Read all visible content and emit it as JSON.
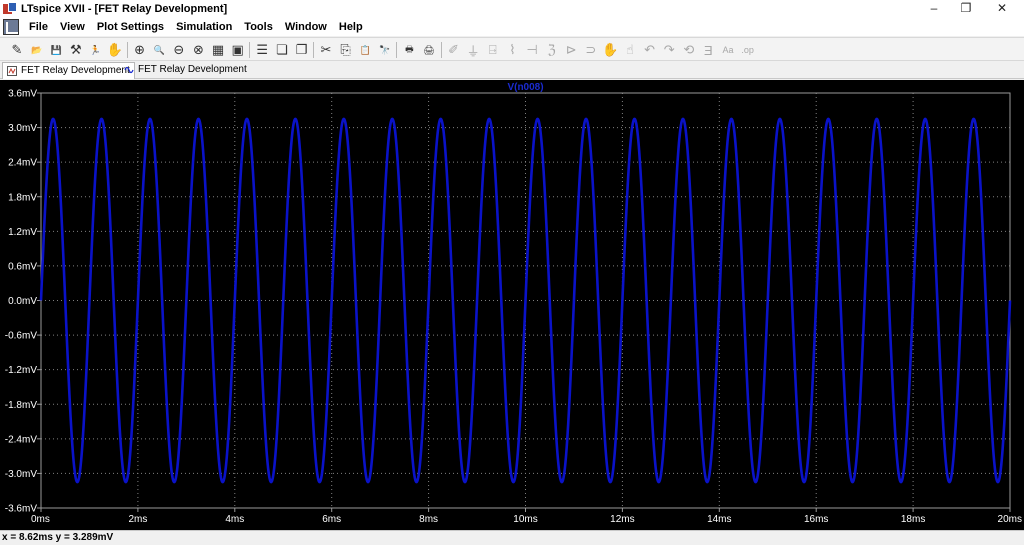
{
  "window": {
    "title": "LTspice XVII - [FET Relay Development]",
    "controls": {
      "minimize": "–",
      "restore": "❐",
      "close": "✕"
    }
  },
  "menubar": {
    "items": [
      "File",
      "View",
      "Plot Settings",
      "Simulation",
      "Tools",
      "Window",
      "Help"
    ],
    "mdi_controls": {
      "minimize": "_",
      "restore": "▫",
      "close": "x"
    }
  },
  "toolbar": {
    "buttons": [
      {
        "name": "open-schematic-icon",
        "glyph": "✎"
      },
      {
        "name": "open-folder-icon",
        "glyph": "📂"
      },
      {
        "name": "save-icon",
        "glyph": "💾"
      },
      {
        "name": "control-panel-icon",
        "glyph": "⚒"
      },
      {
        "name": "run-icon",
        "glyph": "🏃"
      },
      {
        "name": "halt-icon",
        "glyph": "✋"
      },
      {
        "name": "zoom-in-icon",
        "glyph": "⊕"
      },
      {
        "name": "zoom-pan-icon",
        "glyph": "🔍"
      },
      {
        "name": "zoom-out-icon",
        "glyph": "⊖"
      },
      {
        "name": "zoom-fit-icon",
        "glyph": "⊗"
      },
      {
        "name": "autorange-icon",
        "glyph": "▦"
      },
      {
        "name": "fit-icon",
        "glyph": "▣"
      },
      {
        "name": "tile-horizontal-icon",
        "glyph": "☰"
      },
      {
        "name": "cascade-icon",
        "glyph": "❏"
      },
      {
        "name": "tile-vertical-icon",
        "glyph": "❐"
      },
      {
        "name": "cut-icon",
        "glyph": "✂"
      },
      {
        "name": "copy-icon",
        "glyph": "⎘"
      },
      {
        "name": "paste-icon",
        "glyph": "📋"
      },
      {
        "name": "find-icon",
        "glyph": "🔭"
      },
      {
        "name": "print-icon",
        "glyph": "🖶"
      },
      {
        "name": "print-setup-icon",
        "glyph": "🖨"
      },
      {
        "name": "wire-icon",
        "glyph": "✐"
      },
      {
        "name": "ground-icon",
        "glyph": "⏚"
      },
      {
        "name": "label-icon",
        "glyph": "⍈"
      },
      {
        "name": "resistor-icon",
        "glyph": "⌇"
      },
      {
        "name": "capacitor-icon",
        "glyph": "⊣"
      },
      {
        "name": "inductor-icon",
        "glyph": "ℨ"
      },
      {
        "name": "diode-icon",
        "glyph": "⊳"
      },
      {
        "name": "component-icon",
        "glyph": "⊃"
      },
      {
        "name": "move-icon",
        "glyph": "✋"
      },
      {
        "name": "drag-icon",
        "glyph": "☝"
      },
      {
        "name": "undo-icon",
        "glyph": "↶"
      },
      {
        "name": "redo-icon",
        "glyph": "↷"
      },
      {
        "name": "rotate-icon",
        "glyph": "⟲"
      },
      {
        "name": "mirror-icon",
        "glyph": "Ǝ"
      },
      {
        "name": "text-icon",
        "glyph": "Aa"
      },
      {
        "name": "spice-directive-icon",
        "glyph": ".op"
      }
    ]
  },
  "tabs": [
    {
      "label": "FET Relay Development",
      "active": true
    },
    {
      "label": "FET Relay Development",
      "active": false
    }
  ],
  "plot": {
    "trace_label": "V(n008)",
    "colors": {
      "background": "#000000",
      "trace": "#0a12c8",
      "grid": "#808080",
      "label": "#1a2bd0"
    }
  },
  "chart_data": {
    "type": "line",
    "title": "V(n008)",
    "xlabel": "",
    "ylabel": "",
    "xlim": [
      0,
      20
    ],
    "ylim": [
      -3.6,
      3.6
    ],
    "x_unit": "ms",
    "y_unit": "mV",
    "x_ticks": [
      "0ms",
      "2ms",
      "4ms",
      "6ms",
      "8ms",
      "10ms",
      "12ms",
      "14ms",
      "16ms",
      "18ms",
      "20ms"
    ],
    "y_ticks": [
      "3.6mV",
      "3.0mV",
      "2.4mV",
      "1.8mV",
      "1.2mV",
      "0.6mV",
      "0.0mV",
      "-0.6mV",
      "-1.2mV",
      "-1.8mV",
      "-2.4mV",
      "-3.0mV",
      "-3.6mV"
    ],
    "series": [
      {
        "name": "V(n008)",
        "waveform": "sine",
        "amplitude_mV": 3.15,
        "offset_mV": 0,
        "frequency_kHz": 1,
        "phase_deg": 0,
        "x_range_ms": [
          0,
          20
        ]
      }
    ],
    "grid": true,
    "legend": "top-center"
  },
  "status": {
    "cursor_readout": "x = 8.62ms   y = 3.289mV"
  }
}
